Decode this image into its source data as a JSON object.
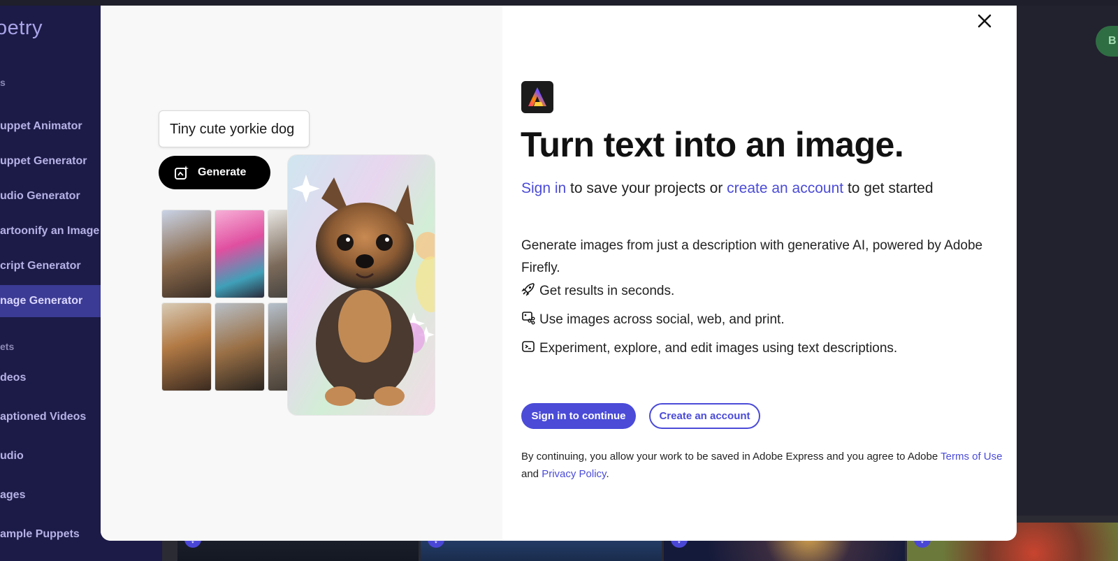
{
  "sidebar": {
    "logo": "oetry",
    "section1": "s",
    "items": [
      {
        "label": "uppet Animator"
      },
      {
        "label": "uppet Generator"
      },
      {
        "label": "udio Generator"
      },
      {
        "label": "artoonify an Image"
      },
      {
        "label": "cript Generator"
      },
      {
        "label": "nage Generator"
      }
    ],
    "section2": "ets",
    "assets": [
      {
        "label": "deos"
      },
      {
        "label": "aptioned Videos"
      },
      {
        "label": "udio"
      },
      {
        "label": "ages"
      },
      {
        "label": "ample Puppets"
      }
    ]
  },
  "topright_button": "B",
  "modal": {
    "prompt_text": "Tiny cute yorkie dog",
    "generate_label": "Generate",
    "headline": "Turn text into an image.",
    "signin_link": "Sign in",
    "subline_mid": " to save your projects or ",
    "create_link": "create an account",
    "subline_end": " to get started",
    "description": "Generate images from just a description with generative AI, powered by Adobe Firefly.",
    "features": [
      {
        "icon": "rocket-icon",
        "text": "Get results in seconds."
      },
      {
        "icon": "image-share-icon",
        "text": "Use images across social, web, and print."
      },
      {
        "icon": "text-prompt-icon",
        "text": "Experiment, explore, and edit images using text descriptions."
      }
    ],
    "primary_button": "Sign in to continue",
    "secondary_button": "Create an account",
    "legal_start": "By continuing, you allow your work to be saved in Adobe Express and you agree to Adobe ",
    "terms_link": "Terms of Use",
    "legal_and": "and ",
    "privacy_link": "Privacy Policy",
    "legal_end": "."
  },
  "colors": {
    "accent": "#4b4bd8",
    "sidebar_bg": "#1c1b47",
    "sidebar_active": "#3b3a94"
  }
}
